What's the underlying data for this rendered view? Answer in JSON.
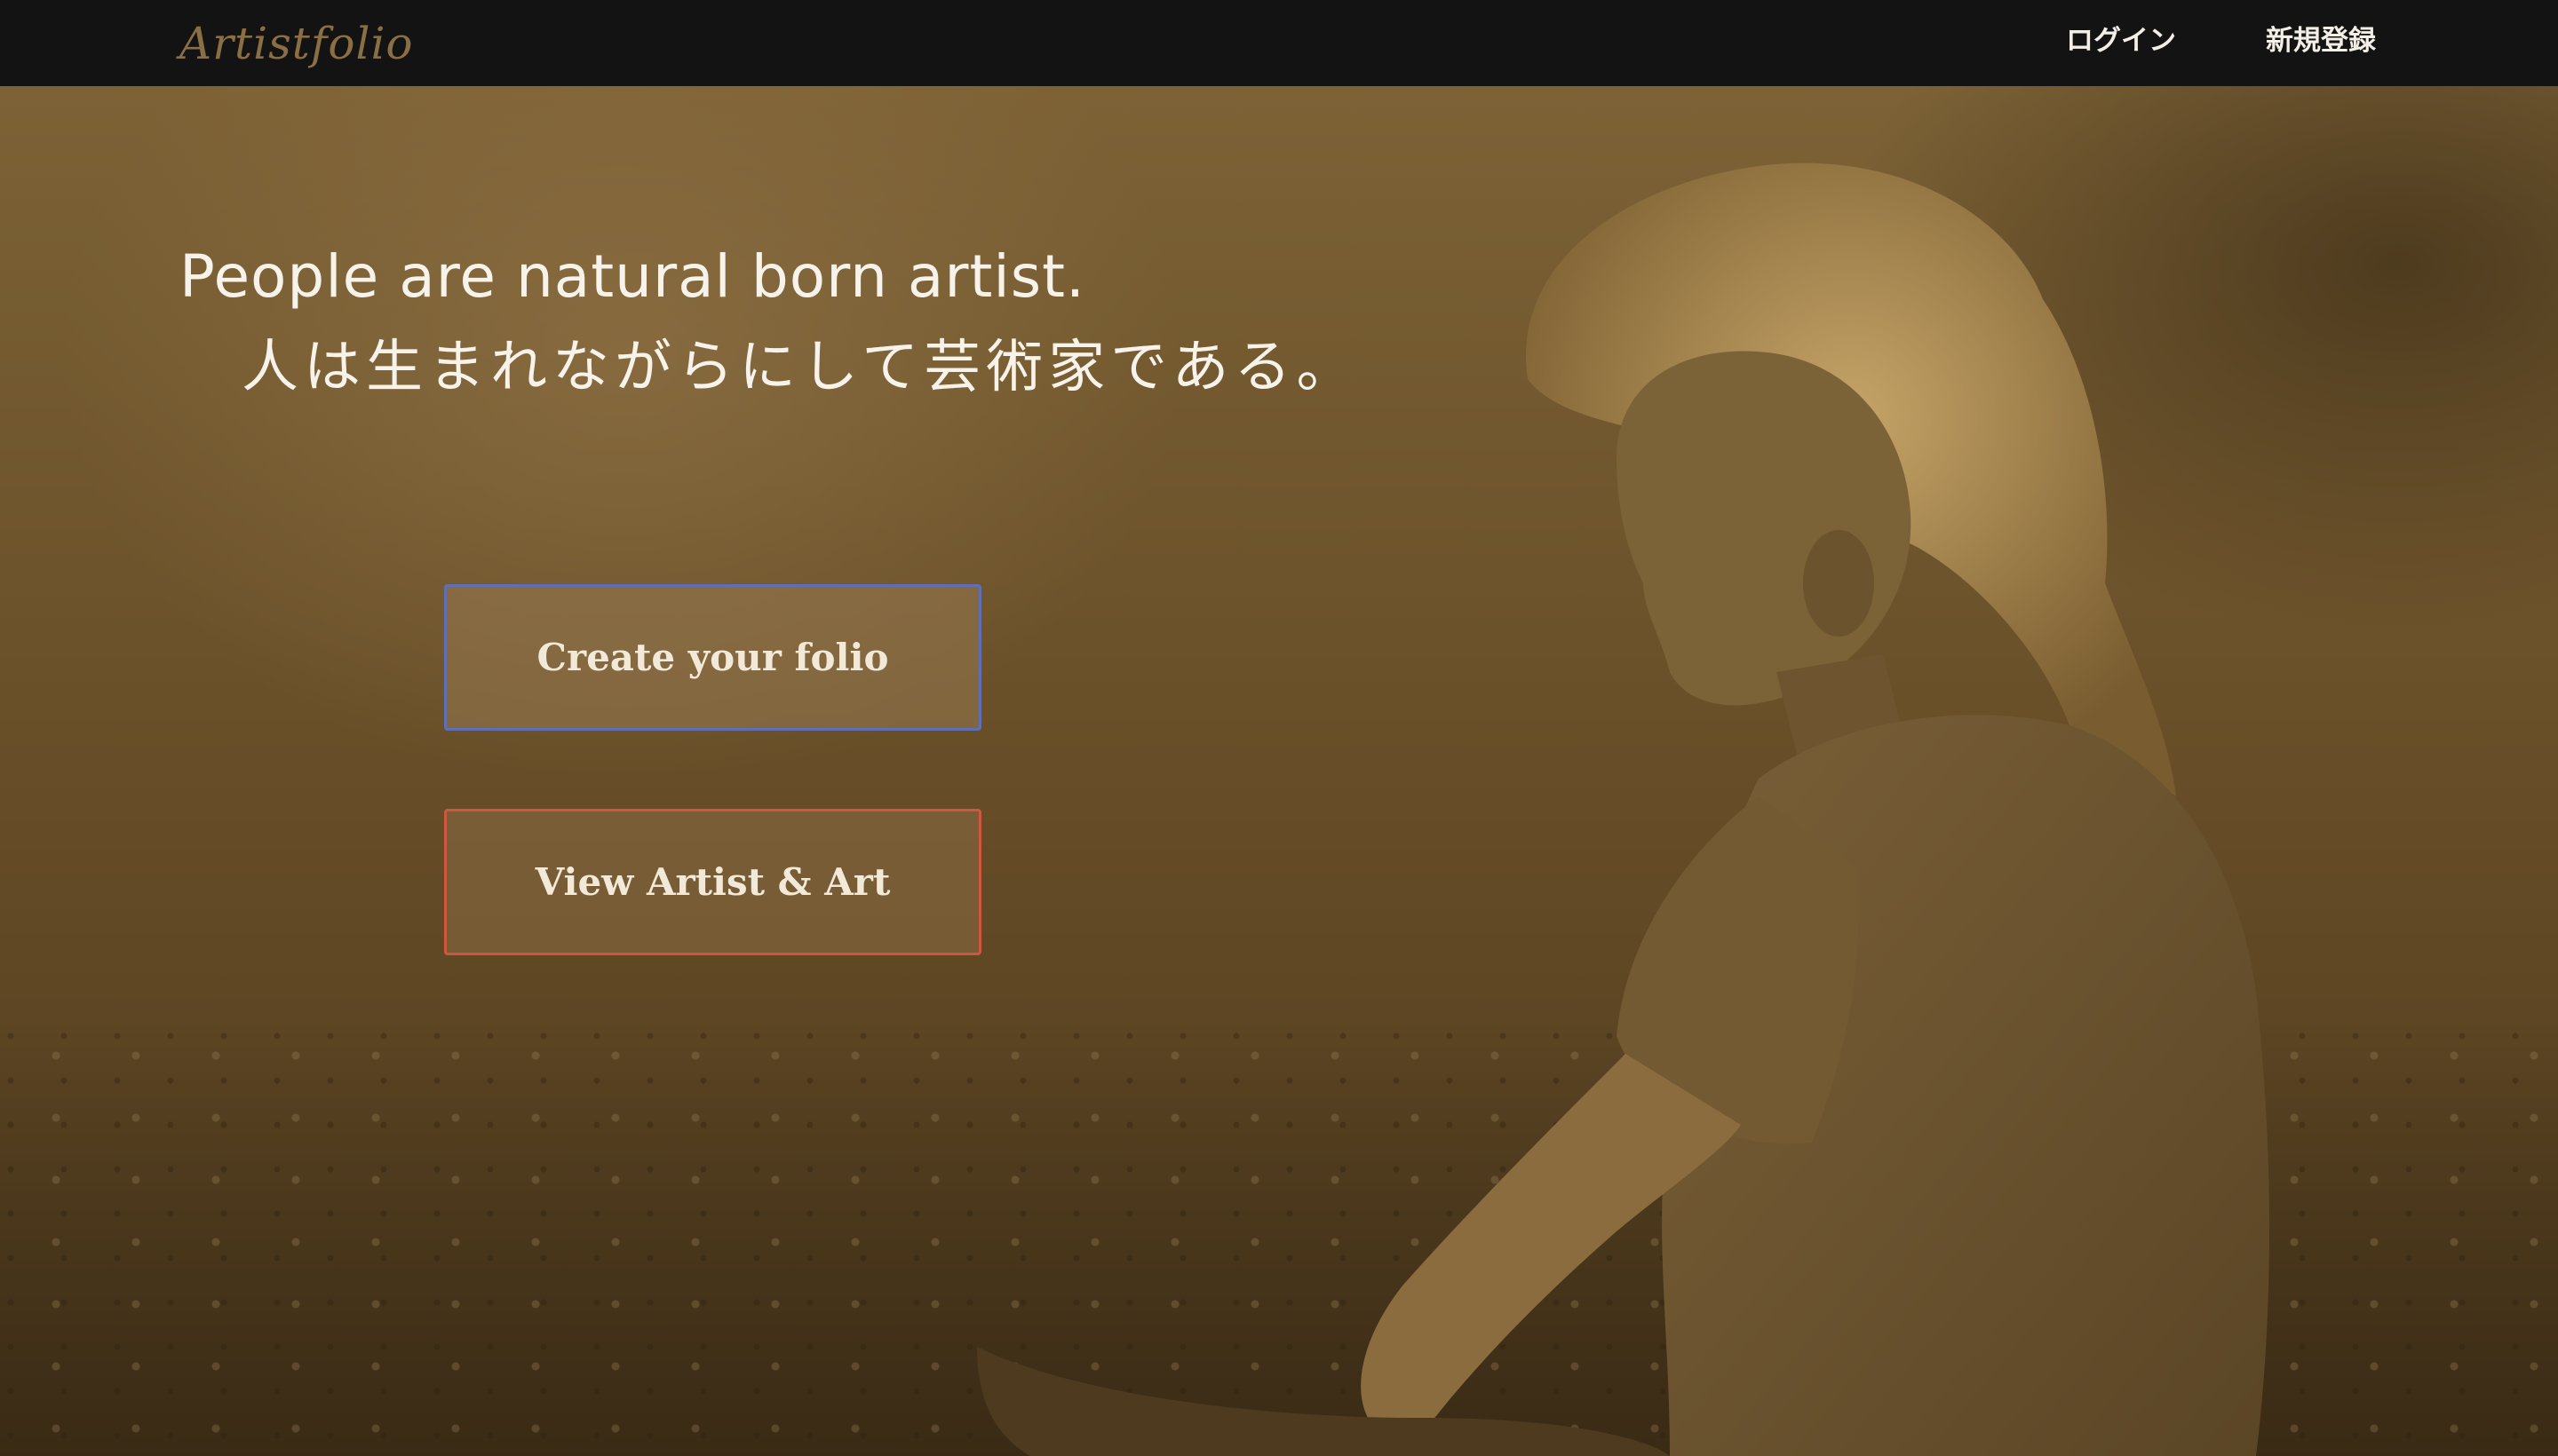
{
  "navbar": {
    "brand": "Artistfolio",
    "links": {
      "login": "ログイン",
      "register": "新規登録"
    },
    "background": "#131313",
    "brand_color": "#8a6e44"
  },
  "hero": {
    "headline_en": "People are natural born artist.",
    "headline_ja": "人は生まれながらにして芸術家である。",
    "buttons": {
      "create": "Create your folio",
      "view": "View Artist & Art"
    },
    "colors": {
      "tint": "#6a5029",
      "create_border": "#5f6fb5",
      "view_border": "#d0573f"
    }
  }
}
